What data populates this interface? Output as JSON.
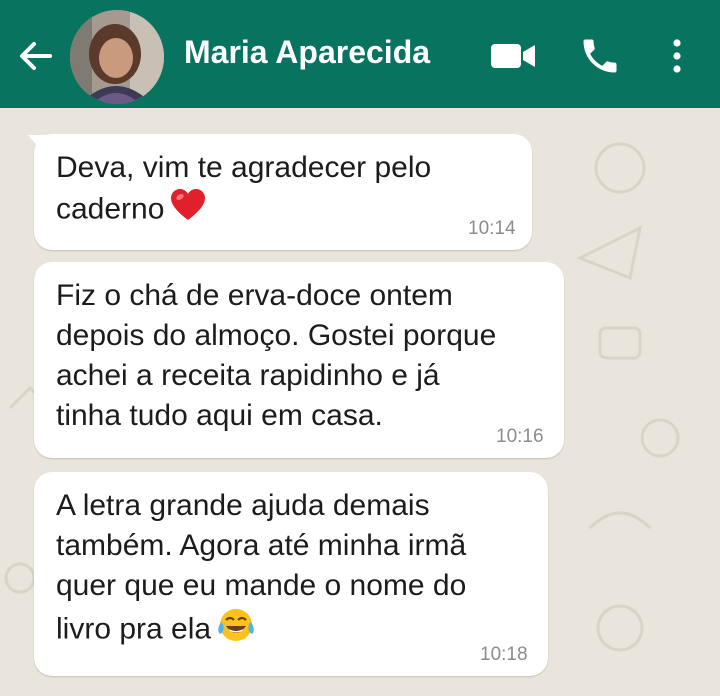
{
  "header": {
    "contact_name": "Maria Aparecida",
    "background_color": "#08735f",
    "icons": [
      "back-arrow-icon",
      "video-camera-icon",
      "phone-icon",
      "more-options-icon"
    ]
  },
  "messages": [
    {
      "lines": [
        "Deva, vim te agradecer pelo",
        "caderno"
      ],
      "trailing_emoji": "red-heart-icon",
      "time": "10:14"
    },
    {
      "lines": [
        "Fiz o chá de erva-doce ontem",
        "depois do almoço. Gostei porque",
        "achei a receita rapidinho e já",
        "tinha tudo aqui em casa."
      ],
      "time": "10:16"
    },
    {
      "lines": [
        "A letra grande ajuda demais",
        "também. Agora até minha irmã",
        "quer que eu mande o nome do",
        "livro pra ela"
      ],
      "trailing_emoji": "tears-of-joy-icon",
      "time": "10:18"
    }
  ]
}
